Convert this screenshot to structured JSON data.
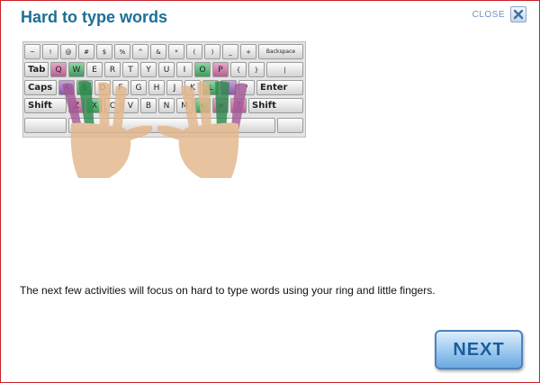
{
  "dialog": {
    "title": "Hard to type words",
    "close_label": "CLOSE",
    "close_icon": "x-icon",
    "message": "The next few activities will focus on hard to type words using your ring and little fingers.",
    "next_label": "NEXT"
  },
  "keyboard": {
    "row1": [
      "~",
      "!",
      "@",
      "#",
      "$",
      "%",
      "^",
      "&",
      "*",
      "(",
      ")",
      "_",
      "+",
      "Backspace"
    ],
    "row2": [
      "Tab",
      "Q",
      "W",
      "E",
      "R",
      "T",
      "Y",
      "U",
      "I",
      "O",
      "P",
      "{",
      "}",
      "|"
    ],
    "row3": [
      "Caps",
      "A",
      "S",
      "D",
      "F",
      "G",
      "H",
      "J",
      "K",
      "L",
      ":",
      "\"",
      "Enter"
    ],
    "row4": [
      "Shift",
      "Z",
      "X",
      "C",
      "V",
      "B",
      "N",
      "M",
      "<",
      ">",
      "?",
      "Shift"
    ]
  },
  "colors": {
    "title": "#1b6f96",
    "border": "#c8222a",
    "little_finger": "#b7608f",
    "ring_finger": "#3f9a5c",
    "purple_finger": "#875aa6",
    "hand": "#e2b68a"
  }
}
